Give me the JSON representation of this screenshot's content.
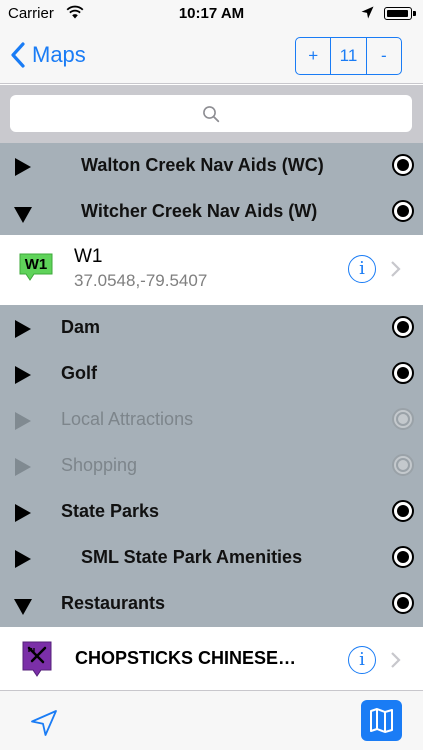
{
  "status_bar": {
    "carrier": "Carrier",
    "time": "10:17 AM"
  },
  "nav": {
    "back_label": "Maps",
    "zoom_in": "+",
    "zoom_level": "11",
    "zoom_out": "-"
  },
  "search": {
    "placeholder": ""
  },
  "list": {
    "folders": [
      {
        "label": "Walton Creek Nav Aids  (WC)",
        "expanded": false,
        "enabled": true
      },
      {
        "label": "Witcher Creek Nav Aids (W)",
        "expanded": true,
        "enabled": true
      },
      {
        "label": "Dam",
        "expanded": false,
        "enabled": true
      },
      {
        "label": "Golf",
        "expanded": false,
        "enabled": true
      },
      {
        "label": "Local Attractions",
        "expanded": false,
        "enabled": false
      },
      {
        "label": "Shopping",
        "expanded": false,
        "enabled": false
      },
      {
        "label": "State Parks",
        "expanded": false,
        "enabled": true
      },
      {
        "label": "SML State Park Amenities",
        "expanded": false,
        "enabled": true
      },
      {
        "label": "Restaurants",
        "expanded": true,
        "enabled": true
      }
    ],
    "items": [
      {
        "icon_text": "W1",
        "title": "W1",
        "subtitle": "37.0548,-79.5407",
        "icon_color": "#5fd35a"
      },
      {
        "title": "CHOPSTICKS CHINESE…",
        "icon_color": "#7b2fa8",
        "icon": "restaurant-icon"
      }
    ],
    "info_label": "i"
  },
  "colors": {
    "accent": "#1a7cf5",
    "folder_bg": "#a6b0b8"
  },
  "toolbar": {
    "locate_icon": "location-arrow-icon",
    "map_icon": "map-icon"
  }
}
